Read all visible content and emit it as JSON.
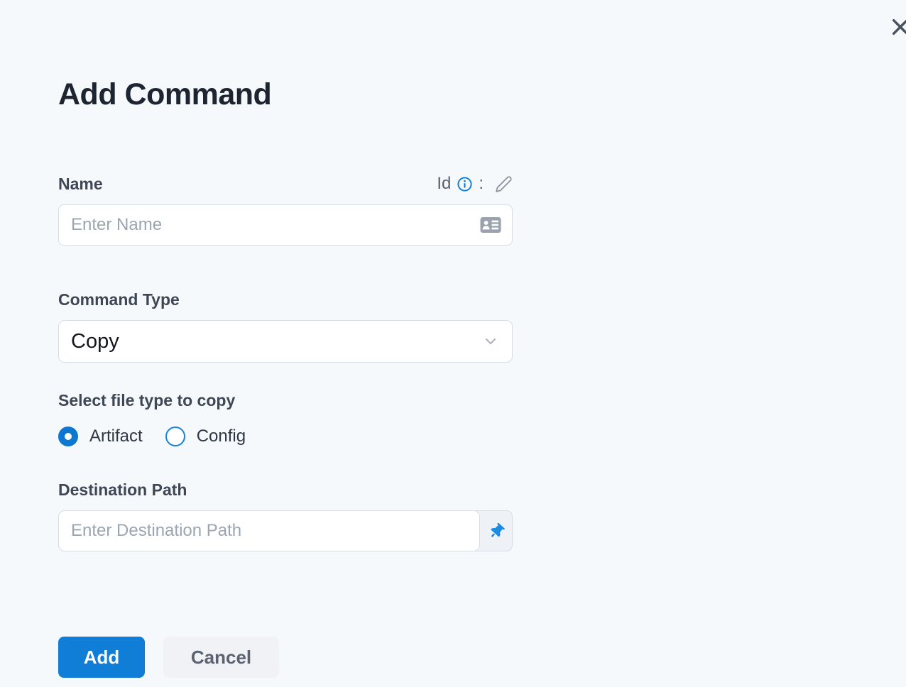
{
  "dialog": {
    "title": "Add Command"
  },
  "fields": {
    "name": {
      "label": "Name",
      "id_label": "Id",
      "colon": ":",
      "placeholder": "Enter Name",
      "value": ""
    },
    "command_type": {
      "label": "Command Type",
      "value": "Copy"
    },
    "file_type": {
      "label": "Select file type to copy",
      "options": [
        {
          "label": "Artifact",
          "selected": true
        },
        {
          "label": "Config",
          "selected": false
        }
      ]
    },
    "destination_path": {
      "label": "Destination Path",
      "placeholder": "Enter Destination Path",
      "value": ""
    }
  },
  "actions": {
    "add_label": "Add",
    "cancel_label": "Cancel"
  },
  "icons": {
    "close": "close-icon",
    "info": "info-icon",
    "edit": "edit-pencil-icon",
    "id_card": "id-card-icon",
    "chevron": "chevron-down-icon",
    "pin": "pushpin-icon"
  },
  "colors": {
    "page_bg": "#f5f9fc",
    "accent_blue": "#107dd6",
    "pin_blue": "#1b8ce2",
    "heading_text": "#1d2530",
    "label_text": "#3f4654",
    "placeholder_text": "#9aa5b2",
    "input_border": "#d8dde6",
    "cancel_bg": "#f0f2f5",
    "cancel_text": "#5b6272"
  }
}
